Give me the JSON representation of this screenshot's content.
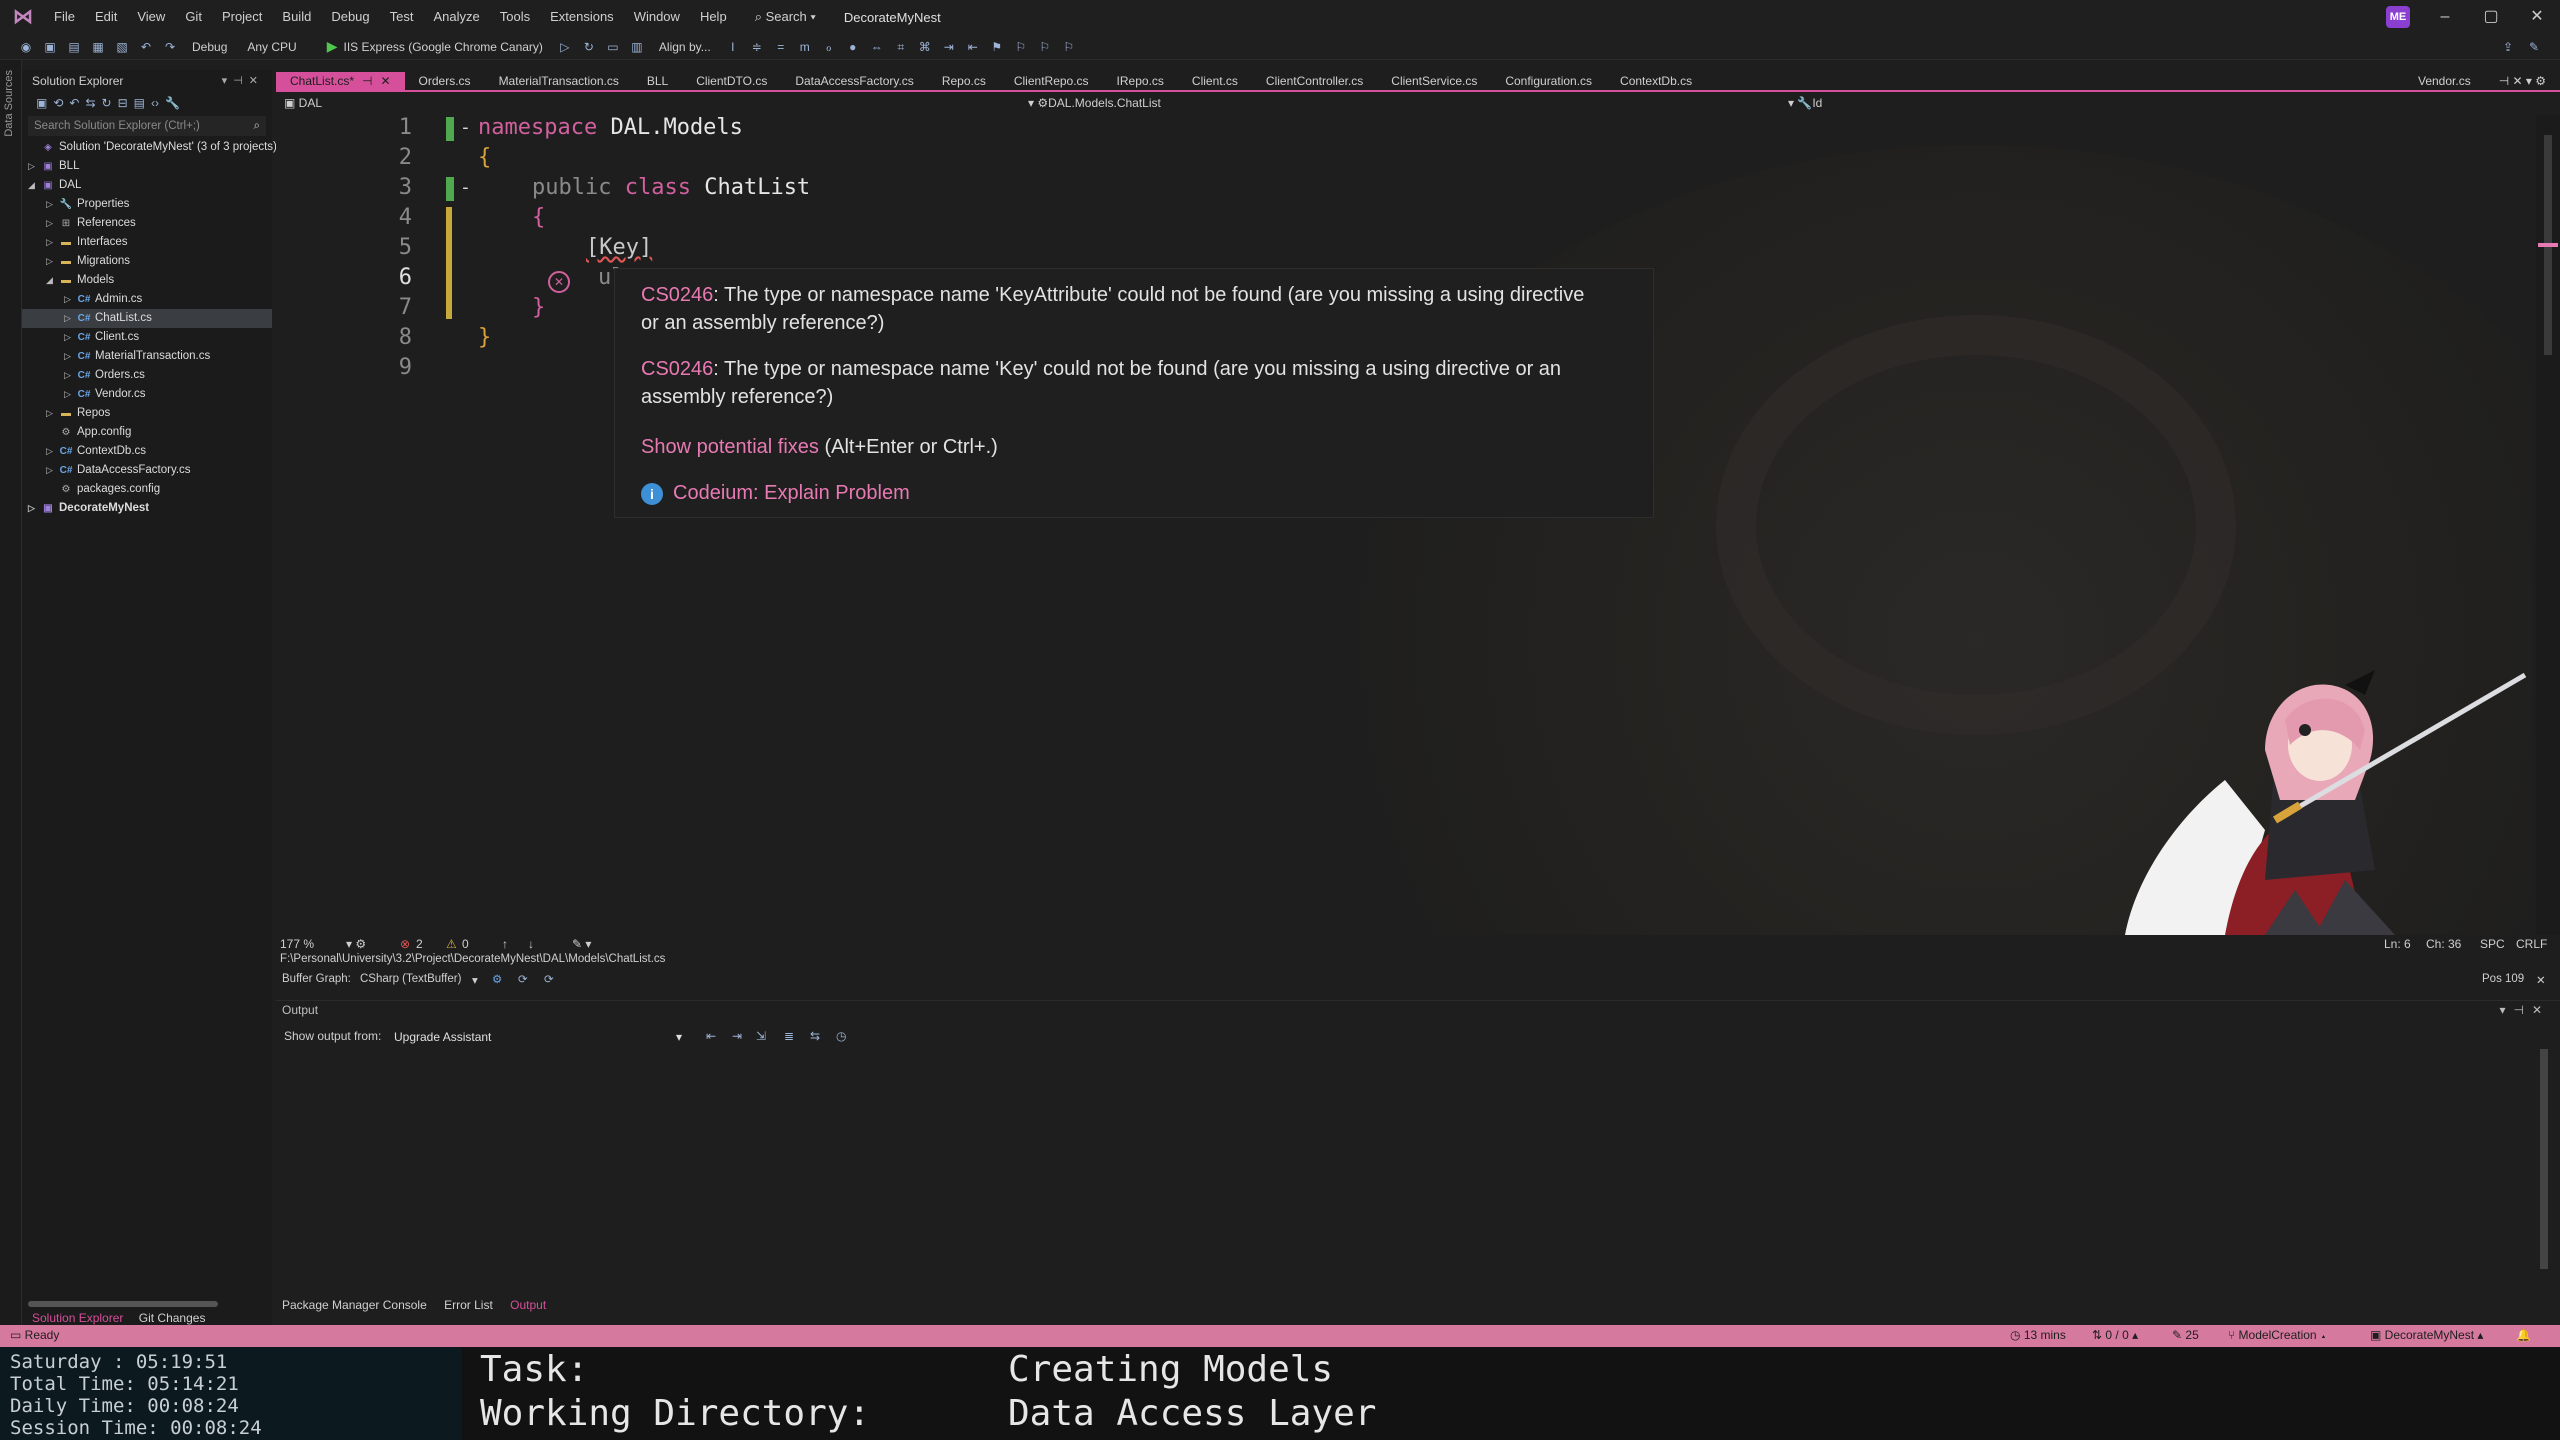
{
  "window": {
    "menus": [
      "File",
      "Edit",
      "View",
      "Git",
      "Project",
      "Build",
      "Debug",
      "Test",
      "Analyze",
      "Tools",
      "Extensions",
      "Window",
      "Help"
    ],
    "search_label": "Search",
    "solution_name": "DecorateMyNest",
    "avatar_initials": "ME"
  },
  "toolbar": {
    "config": "Debug",
    "platform": "Any CPU",
    "run_target": "IIS Express (Google Chrome Canary)",
    "align_label": "Align by..."
  },
  "left_strip_label": "Data Sources",
  "solution_explorer": {
    "title": "Solution Explorer",
    "search_placeholder": "Search Solution Explorer (Ctrl+;)",
    "items": [
      {
        "label": "Solution 'DecorateMyNest' (3 of 3 projects)",
        "icon": "solution-icon"
      },
      {
        "label": "BLL",
        "icon": "project-icon"
      },
      {
        "label": "DAL",
        "icon": "project-icon"
      },
      {
        "label": "Properties",
        "icon": "wrench-icon"
      },
      {
        "label": "References",
        "icon": "references-icon"
      },
      {
        "label": "Interfaces",
        "icon": "folder-icon"
      },
      {
        "label": "Migrations",
        "icon": "folder-icon"
      },
      {
        "label": "Models",
        "icon": "folder-icon"
      },
      {
        "label": "Admin.cs",
        "icon": "csharp-icon"
      },
      {
        "label": "ChatList.cs",
        "icon": "csharp-icon"
      },
      {
        "label": "Client.cs",
        "icon": "csharp-icon"
      },
      {
        "label": "MaterialTransaction.cs",
        "icon": "csharp-icon"
      },
      {
        "label": "Orders.cs",
        "icon": "csharp-icon"
      },
      {
        "label": "Vendor.cs",
        "icon": "csharp-icon"
      },
      {
        "label": "Repos",
        "icon": "folder-icon"
      },
      {
        "label": "App.config",
        "icon": "config-icon"
      },
      {
        "label": "ContextDb.cs",
        "icon": "csharp-icon"
      },
      {
        "label": "DataAccessFactory.cs",
        "icon": "csharp-icon"
      },
      {
        "label": "packages.config",
        "icon": "config-icon"
      },
      {
        "label": "DecorateMyNest",
        "icon": "project-icon"
      }
    ],
    "bottom_tabs": [
      "Solution Explorer",
      "Git Changes"
    ]
  },
  "tabs": {
    "active": "ChatList.cs*",
    "others": [
      "Orders.cs",
      "MaterialTransaction.cs",
      "BLL",
      "ClientDTO.cs",
      "DataAccessFactory.cs",
      "Repo.cs",
      "ClientRepo.cs",
      "IRepo.cs",
      "Client.cs",
      "ClientController.cs",
      "ClientService.cs",
      "Configuration.cs",
      "ContextDb.cs"
    ],
    "right": "Vendor.cs"
  },
  "navbar": {
    "project": "DAL",
    "type": "DAL.Models.ChatList",
    "member": "Id"
  },
  "editor": {
    "line_numbers": [
      "1",
      "2",
      "3",
      "4",
      "5",
      "6",
      "7",
      "8",
      "9"
    ],
    "line1_kw": "namespace",
    "line1_name": "DAL.Models",
    "line2": "{",
    "line3_kw1": "public",
    "line3_kw2": "class",
    "line3_name": "ChatList",
    "line4": "{",
    "line5": "[Key]",
    "line6_partial": "ul",
    "line7": "}",
    "line8": "}"
  },
  "tooltip": {
    "err1_code": "CS0246",
    "err1_text": ": The type or namespace name 'KeyAttribute' could not be found (are you missing a using directive",
    "err1_text2": "or an assembly reference?)",
    "err2_code": "CS0246",
    "err2_text": ": The type or namespace name 'Key' could not be found (are you missing a using directive or an",
    "err2_text2": "assembly reference?)",
    "fix_link": "Show potential fixes",
    "fix_shortcut": " (Alt+Enter or Ctrl+.)",
    "codeium": "Codeium: Explain Problem"
  },
  "editor_status": {
    "zoom": "177 %",
    "errors": "2",
    "warnings": "0",
    "ln": "Ln: 6",
    "ch": "Ch: 36",
    "spc": "SPC",
    "crlf": "CRLF",
    "pos": "Pos 109"
  },
  "path": "F:\\Personal\\University\\3.2\\Project\\DecorateMyNest\\DAL\\Models\\ChatList.cs",
  "buffer_graph": {
    "label": "Buffer Graph:",
    "value": "CSharp (TextBuffer)"
  },
  "output": {
    "title": "Output",
    "show_from": "Show output from:",
    "source": "Upgrade Assistant",
    "bottom_tabs": [
      "Package Manager Console",
      "Error List",
      "Output"
    ]
  },
  "statusbar": {
    "ready": "Ready",
    "time": "13 mins",
    "updown": "0 / 0",
    "pencil": "25",
    "branch": "ModelCreation",
    "repo": "DecorateMyNest"
  },
  "overlay": {
    "day_line": "Saturday  :  05:19:51",
    "total": "Total Time: 05:14:21",
    "daily": "Daily Time: 00:08:24",
    "session": "Session Time: 00:08:24",
    "task_label": "Task:",
    "task_value": "Creating Models",
    "dir_label": "Working Directory:",
    "dir_value": "Data Access Layer"
  },
  "colors": {
    "accent": "#d64f9a",
    "statusbar": "#d6799e"
  }
}
